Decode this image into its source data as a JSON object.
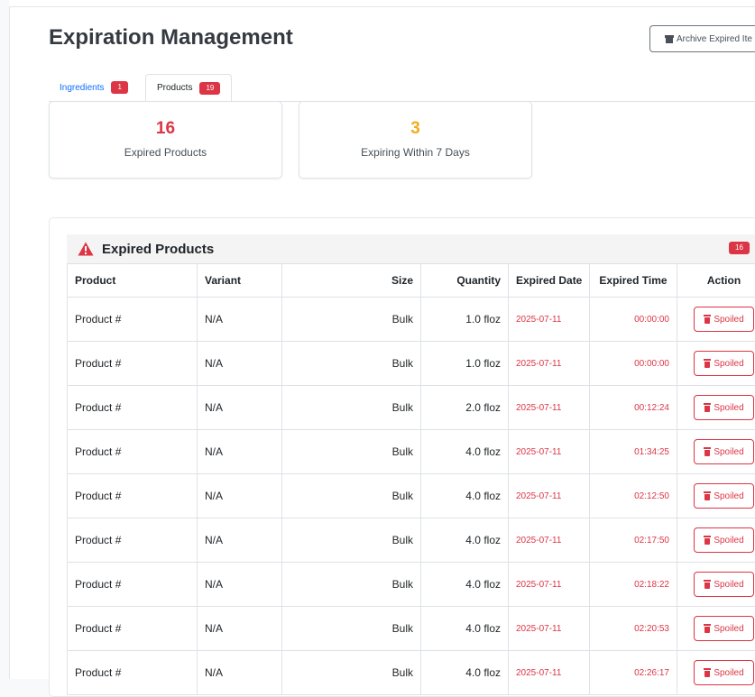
{
  "header": {
    "title": "Expiration Management",
    "archive_button_label": "Archive Expired Ite"
  },
  "tabs": [
    {
      "label": "Ingredients",
      "count": "1",
      "active": false
    },
    {
      "label": "Products",
      "count": "19",
      "active": true
    }
  ],
  "stats": [
    {
      "value": "16",
      "label": "Expired Products",
      "color": "#dc3545"
    },
    {
      "value": "3",
      "label": "Expiring Within 7 Days",
      "color": "#f0ad1f"
    }
  ],
  "section": {
    "title": "Expired Products",
    "count": "16",
    "icon": "warning-triangle-icon"
  },
  "table": {
    "columns": [
      "Product",
      "Variant",
      "Size",
      "Quantity",
      "Expired Date",
      "Expired Time",
      "Action"
    ],
    "action_label": "Spoiled",
    "rows": [
      {
        "product": "Product #",
        "variant": "N/A",
        "size": "Bulk",
        "quantity": "1.0 floz",
        "expired_date": "2025-07-11",
        "expired_time": "00:00:00"
      },
      {
        "product": "Product #",
        "variant": "N/A",
        "size": "Bulk",
        "quantity": "1.0 floz",
        "expired_date": "2025-07-11",
        "expired_time": "00:00:00"
      },
      {
        "product": "Product #",
        "variant": "N/A",
        "size": "Bulk",
        "quantity": "2.0 floz",
        "expired_date": "2025-07-11",
        "expired_time": "00:12:24"
      },
      {
        "product": "Product #",
        "variant": "N/A",
        "size": "Bulk",
        "quantity": "4.0 floz",
        "expired_date": "2025-07-11",
        "expired_time": "01:34:25"
      },
      {
        "product": "Product #",
        "variant": "N/A",
        "size": "Bulk",
        "quantity": "4.0 floz",
        "expired_date": "2025-07-11",
        "expired_time": "02:12:50"
      },
      {
        "product": "Product #",
        "variant": "N/A",
        "size": "Bulk",
        "quantity": "4.0 floz",
        "expired_date": "2025-07-11",
        "expired_time": "02:17:50"
      },
      {
        "product": "Product #",
        "variant": "N/A",
        "size": "Bulk",
        "quantity": "4.0 floz",
        "expired_date": "2025-07-11",
        "expired_time": "02:18:22"
      },
      {
        "product": "Product #",
        "variant": "N/A",
        "size": "Bulk",
        "quantity": "4.0 floz",
        "expired_date": "2025-07-11",
        "expired_time": "02:20:53"
      },
      {
        "product": "Product #",
        "variant": "N/A",
        "size": "Bulk",
        "quantity": "4.0 floz",
        "expired_date": "2025-07-11",
        "expired_time": "02:26:17"
      }
    ]
  }
}
